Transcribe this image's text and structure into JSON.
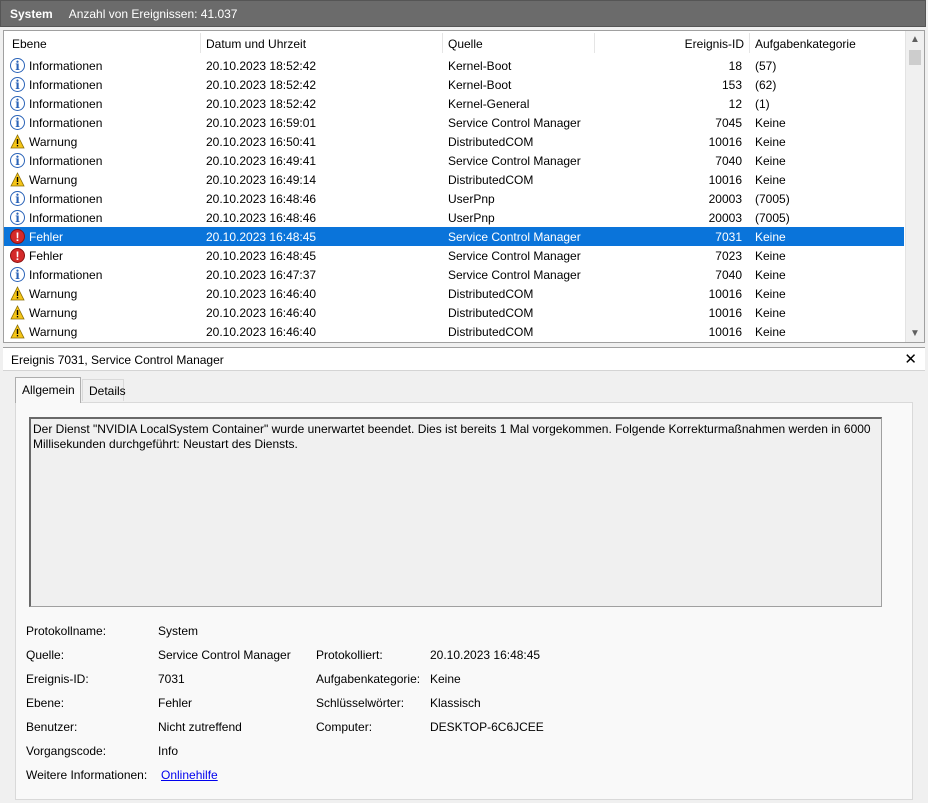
{
  "titlebar": {
    "log": "System",
    "count_label": "Anzahl von Ereignissen: 41.037"
  },
  "columns": {
    "level": "Ebene",
    "date": "Datum und Uhrzeit",
    "source": "Quelle",
    "id": "Ereignis-ID",
    "category": "Aufgabenkategorie"
  },
  "events": [
    {
      "icon": "info-icon",
      "level": "Informationen",
      "date": "20.10.2023 18:52:42",
      "source": "Kernel-Boot",
      "id": "18",
      "category": "(57)"
    },
    {
      "icon": "info-icon",
      "level": "Informationen",
      "date": "20.10.2023 18:52:42",
      "source": "Kernel-Boot",
      "id": "153",
      "category": "(62)"
    },
    {
      "icon": "info-icon",
      "level": "Informationen",
      "date": "20.10.2023 18:52:42",
      "source": "Kernel-General",
      "id": "12",
      "category": "(1)"
    },
    {
      "icon": "info-icon",
      "level": "Informationen",
      "date": "20.10.2023 16:59:01",
      "source": "Service Control Manager",
      "id": "7045",
      "category": "Keine"
    },
    {
      "icon": "warning-icon",
      "level": "Warnung",
      "date": "20.10.2023 16:50:41",
      "source": "DistributedCOM",
      "id": "10016",
      "category": "Keine"
    },
    {
      "icon": "info-icon",
      "level": "Informationen",
      "date": "20.10.2023 16:49:41",
      "source": "Service Control Manager",
      "id": "7040",
      "category": "Keine"
    },
    {
      "icon": "warning-icon",
      "level": "Warnung",
      "date": "20.10.2023 16:49:14",
      "source": "DistributedCOM",
      "id": "10016",
      "category": "Keine"
    },
    {
      "icon": "info-icon",
      "level": "Informationen",
      "date": "20.10.2023 16:48:46",
      "source": "UserPnp",
      "id": "20003",
      "category": "(7005)"
    },
    {
      "icon": "info-icon",
      "level": "Informationen",
      "date": "20.10.2023 16:48:46",
      "source": "UserPnp",
      "id": "20003",
      "category": "(7005)"
    },
    {
      "icon": "error-icon",
      "level": "Fehler",
      "date": "20.10.2023 16:48:45",
      "source": "Service Control Manager",
      "id": "7031",
      "category": "Keine",
      "selected": true
    },
    {
      "icon": "error-icon",
      "level": "Fehler",
      "date": "20.10.2023 16:48:45",
      "source": "Service Control Manager",
      "id": "7023",
      "category": "Keine"
    },
    {
      "icon": "info-icon",
      "level": "Informationen",
      "date": "20.10.2023 16:47:37",
      "source": "Service Control Manager",
      "id": "7040",
      "category": "Keine"
    },
    {
      "icon": "warning-icon",
      "level": "Warnung",
      "date": "20.10.2023 16:46:40",
      "source": "DistributedCOM",
      "id": "10016",
      "category": "Keine"
    },
    {
      "icon": "warning-icon",
      "level": "Warnung",
      "date": "20.10.2023 16:46:40",
      "source": "DistributedCOM",
      "id": "10016",
      "category": "Keine"
    },
    {
      "icon": "warning-icon",
      "level": "Warnung",
      "date": "20.10.2023 16:46:40",
      "source": "DistributedCOM",
      "id": "10016",
      "category": "Keine"
    }
  ],
  "detail": {
    "title": "Ereignis 7031, Service Control Manager",
    "close": "✕",
    "tabs": {
      "general": "Allgemein",
      "details": "Details"
    },
    "message": "Der Dienst \"NVIDIA LocalSystem Container\" wurde unerwartet beendet. Dies ist bereits 1 Mal vorgekommen. Folgende Korrekturmaßnahmen werden in 6000 Millisekunden durchgeführt: Neustart des Diensts.",
    "labels": {
      "log_name": "Protokollname:",
      "source": "Quelle:",
      "event_id": "Ereignis-ID:",
      "level": "Ebene:",
      "user": "Benutzer:",
      "opcode": "Vorgangscode:",
      "more_info": "Weitere Informationen:",
      "logged": "Protokolliert:",
      "task_category": "Aufgabenkategorie:",
      "keywords": "Schlüsselwörter:",
      "computer": "Computer:"
    },
    "values": {
      "log_name": "System",
      "source": "Service Control Manager",
      "event_id": "7031",
      "level": "Fehler",
      "user": "Nicht zutreffend",
      "opcode": "Info",
      "more_info_link": "Onlinehilfe",
      "logged": "20.10.2023 16:48:45",
      "task_category": "Keine",
      "keywords": "Klassisch",
      "computer": "DESKTOP-6C6JCEE"
    }
  },
  "colors": {
    "selection": "#0a74da",
    "titlebar": "#6b6b6b",
    "warning": "#f5c518",
    "error": "#d42a2a",
    "info": "#2a63b8"
  }
}
